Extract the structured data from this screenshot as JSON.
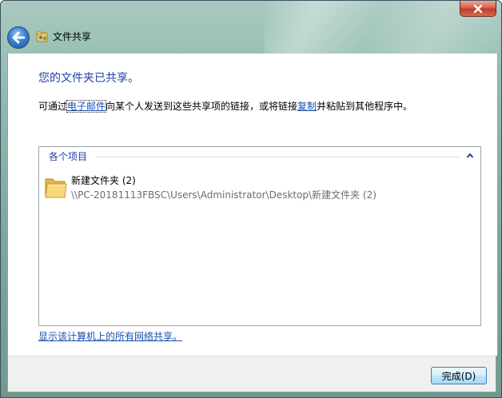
{
  "window": {
    "title": "文件共享"
  },
  "main": {
    "heading": "您的文件夹已共享。",
    "description": {
      "part1": "可通过",
      "email_link": "电子邮件",
      "part2": "向某个人发送到这些共享项的链接，或将链接",
      "copy_link": "复制",
      "part3": "并粘贴到其他程序中。"
    },
    "items_panel": {
      "group_label": "各个项目",
      "items": [
        {
          "name": "新建文件夹 (2)",
          "path": "\\\\PC-20181113FBSC\\Users\\Administrator\\Desktop\\新建文件夹 (2)"
        }
      ]
    },
    "show_all_link": "显示该计算机上的所有网络共享。"
  },
  "footer": {
    "done_label": "完成(D)"
  },
  "colors": {
    "heading": "#1e3fa6",
    "link": "#1a4fb0",
    "close_button": "#c0392b"
  }
}
